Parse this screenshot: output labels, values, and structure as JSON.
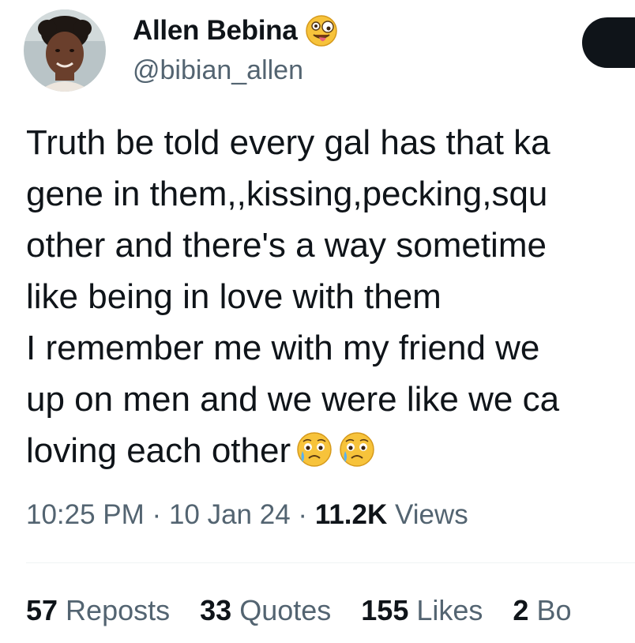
{
  "author": {
    "display_name": "Allen Bebina",
    "name_emoji_icon": "zany-face-icon",
    "handle": "@bibian_allen"
  },
  "tweet": {
    "lines": [
      "Truth be told every gal has that ka",
      "gene in them,,kissing,pecking,squ",
      "other and there's a way sometime",
      "like being in love with them",
      "I remember me with my friend we",
      "up on men and we were like we ca",
      "loving each other"
    ],
    "trailing_emojis": [
      "crying-face-icon",
      "crying-face-icon"
    ]
  },
  "meta": {
    "time": "10:25 PM",
    "separator": "·",
    "date": "10 Jan 24",
    "views_count": "11.2K",
    "views_label": "Views"
  },
  "stats": {
    "reposts_count": "57",
    "reposts_label": "Reposts",
    "quotes_count": "33",
    "quotes_label": "Quotes",
    "likes_count": "155",
    "likes_label": "Likes",
    "bookmarks_count": "2",
    "bookmarks_label": "Bo"
  },
  "colors": {
    "text_primary": "#0f1419",
    "text_secondary": "#536471",
    "divider": "#eff3f4",
    "button_dark": "#0f1419",
    "emoji_yellow": "#f7c33b",
    "tear_blue": "#5ab2f0"
  }
}
